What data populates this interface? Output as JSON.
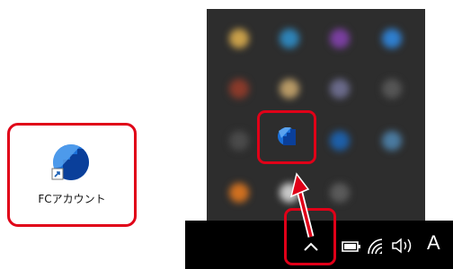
{
  "desktop": {
    "shortcut_label": "FCアカウント",
    "shortcut_icon": "fc-account-app-icon"
  },
  "tray_overflow": {
    "icons": [
      "blurred-tray-app-icon",
      "blurred-tray-app-icon",
      "blurred-tray-app-icon",
      "blurred-tray-app-icon",
      "blurred-tray-app-icon",
      "blurred-tray-app-icon",
      "blurred-tray-app-icon",
      "blurred-tray-app-icon",
      "blurred-tray-app-icon",
      "fc-account-tray-icon",
      "blurred-tray-app-icon",
      "blurred-tray-app-icon",
      "blurred-tray-app-icon",
      "blurred-tray-app-icon"
    ]
  },
  "taskbar": {
    "ime_label": "A",
    "icons": [
      "chevron-up-icon",
      "battery-icon",
      "wifi-icon",
      "volume-icon"
    ]
  },
  "colors": {
    "highlight": "#e00018",
    "panel": "#2d2d2d",
    "taskbar": "#000000",
    "app_blue": "#1a6fd8"
  }
}
